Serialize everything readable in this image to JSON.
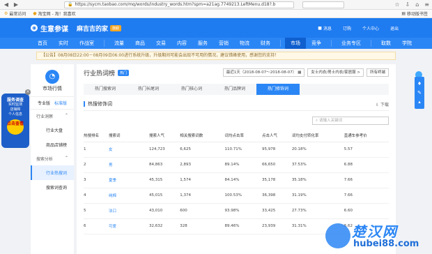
{
  "browser": {
    "url": "https://sycm.taobao.com/mq/words/industry_words.htm?spm=a21ag.7749213.LeftMenu.d18?.b",
    "bookmarks": [
      "最常访问",
      "淘宝网 - 淘！我喜欢"
    ],
    "bookmark_right": "移动版书签"
  },
  "header": {
    "logo": "生意参谋",
    "shop_name": "麻吉吉的家",
    "shop_badge": "旗舰",
    "right_items": [
      "消息",
      "订购",
      "个人中心",
      "退出"
    ]
  },
  "nav": {
    "items": [
      "首页",
      "实时",
      "作战室",
      "流量",
      "商品",
      "交易",
      "内容",
      "服务",
      "营销",
      "物流",
      "财务",
      "市场",
      "竞争",
      "业务专区",
      "取数",
      "学院"
    ],
    "active": "市场"
  },
  "notice": "【公告】08月08日22:00－08月09日06:00进行系统升级，升级期间可能会出现不可用的情况，建议错峰使用，感谢您的支持！",
  "sidebar": {
    "title": "市场行情",
    "tabs": [
      "专业版",
      "标准版"
    ],
    "groups": [
      {
        "label": "行业洞察",
        "links": [
          "行业大盘",
          "商品店铺榜"
        ]
      },
      {
        "label": "搜索分析",
        "links": [
          "行业热搜词",
          "搜索词查询"
        ]
      }
    ],
    "active_link": "行业热搜词"
  },
  "float_ad": {
    "title": "服务调查",
    "lines": [
      "实时监测",
      "店铺和",
      "个人信息"
    ],
    "button": "点击查看"
  },
  "content": {
    "title": "行业热词榜",
    "title_badge": "热门",
    "date_range": "最近1天（2018-08-07～2018-08-07）",
    "category_select": "女士内衣/男士内衣/家居服 >",
    "terminal_select": "所有终端",
    "sub_tabs": [
      "热门搜索词",
      "热门长尾词",
      "热门核心词",
      "热门品牌词",
      "热门修饰词"
    ],
    "active_sub_tab": "热门修饰词",
    "section_title": "热搜修饰词",
    "download": "下载",
    "search_placeholder": "请输入关键词"
  },
  "table": {
    "columns": [
      "热搜排名",
      "搜索词",
      "搜索人气",
      "相关搜索词数",
      "词均点击率",
      "点击人气",
      "词均支付转化率",
      "直通车参考价"
    ],
    "rows": [
      [
        "1",
        "女",
        "124,723",
        "6,625",
        "110.71%",
        "95,978",
        "20.18%",
        "5.57"
      ],
      [
        "2",
        "男",
        "84,863",
        "2,893",
        "89.14%",
        "66,650",
        "37.53%",
        "6.88"
      ],
      [
        "3",
        "夏季",
        "45,315",
        "1,574",
        "84.14%",
        "35,178",
        "35.18%",
        "7.66"
      ],
      [
        "4",
        "纯棉",
        "45,015",
        "1,374",
        "100.53%",
        "36,398",
        "31.19%",
        "7.66"
      ],
      [
        "5",
        "法口",
        "43,010",
        "600",
        "93.98%",
        "33,425",
        "27.73%",
        "6.60"
      ],
      [
        "6",
        "可爱",
        "32,632",
        "328",
        "89.46%",
        "23,939",
        "31.31%",
        "6.62"
      ]
    ]
  },
  "watermark": {
    "text": "楚汉网",
    "url": "hubei88.com"
  }
}
